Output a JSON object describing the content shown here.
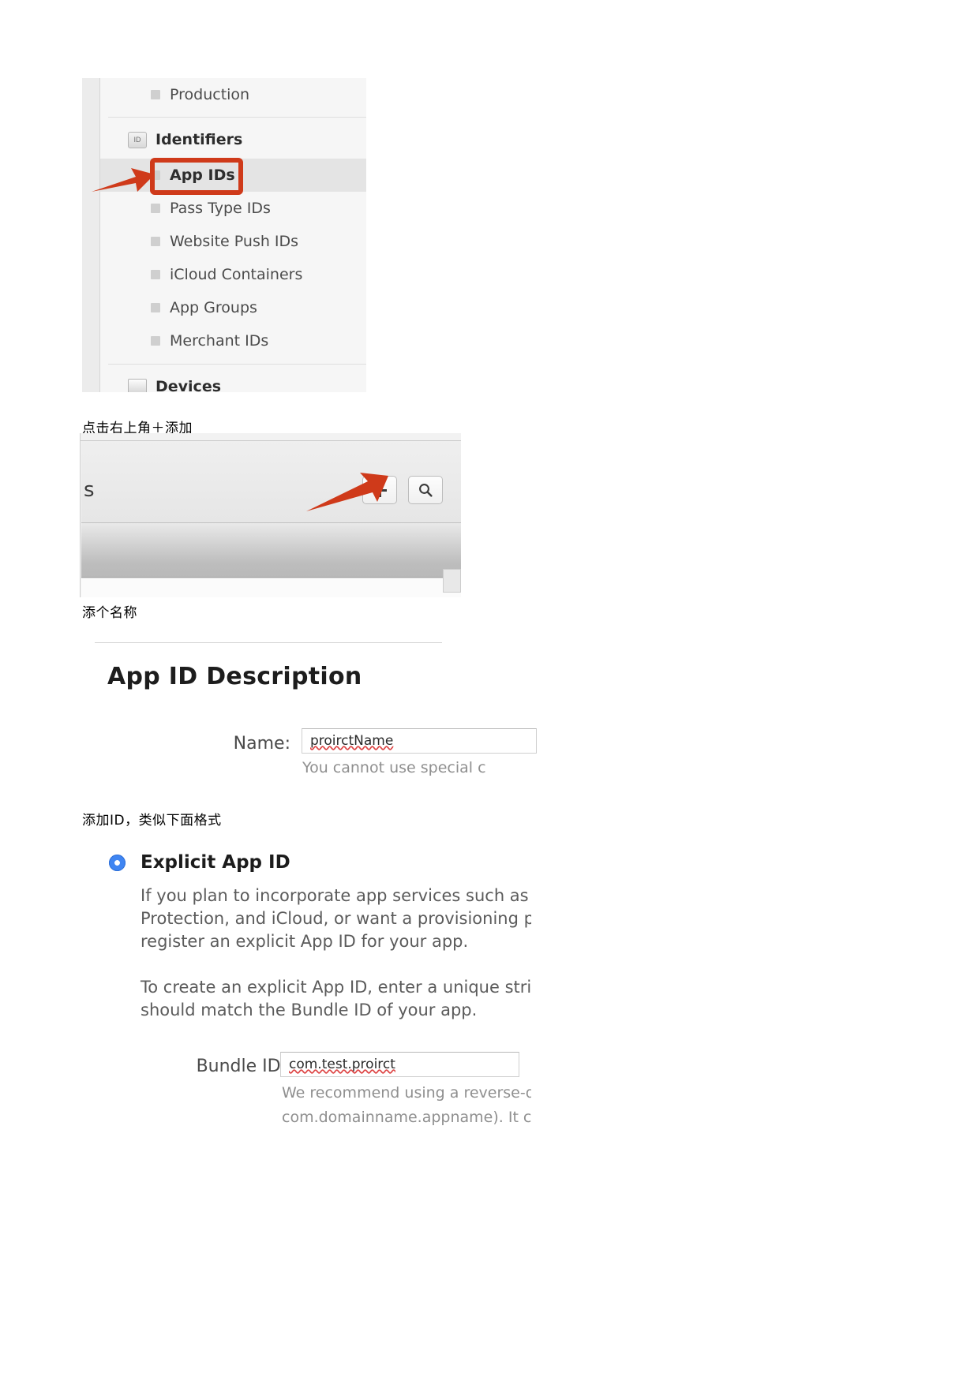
{
  "figure1": {
    "nav_items": [
      {
        "label": "Production",
        "type": "item",
        "selected": false
      },
      {
        "label": "Identifiers",
        "type": "group",
        "icon": "id-badge-icon",
        "icon_text": "ID"
      },
      {
        "label": "App IDs",
        "type": "item",
        "selected": true
      },
      {
        "label": "Pass Type IDs",
        "type": "item",
        "selected": false
      },
      {
        "label": "Website Push IDs",
        "type": "item",
        "selected": false
      },
      {
        "label": "iCloud Containers",
        "type": "item",
        "selected": false
      },
      {
        "label": "App Groups",
        "type": "item",
        "selected": false
      },
      {
        "label": "Merchant IDs",
        "type": "item",
        "selected": false
      },
      {
        "label": "Devices",
        "type": "group",
        "icon": "device-icon",
        "icon_text": ""
      }
    ],
    "highlight_color": "#cf3a1a",
    "arrow_color": "#cf3a1a"
  },
  "caption1": "点击右上角＋添加",
  "figure2": {
    "title_fragment": "s",
    "add_button_label": "+",
    "search_button_label": "search-icon",
    "arrow_color": "#cf3a1a"
  },
  "caption2": "添个名称",
  "figure3": {
    "heading": "App ID Description",
    "name_label": "Name:",
    "name_value": "proirctName",
    "name_hint": "You cannot use special c"
  },
  "caption3": "添加ID，类似下面格式",
  "figure4": {
    "option_title": "Explicit App ID",
    "paragraph1_lines": [
      "If you plan to incorporate app services such as G",
      "Protection, and iCloud, or want a provisioning pr",
      "register an explicit App ID for your app."
    ],
    "paragraph2_lines": [
      "To create an explicit App ID, enter a unique strin",
      "should match the Bundle ID of your app."
    ],
    "bundle_label": "Bundle ID:",
    "bundle_value": "com.test.proirct",
    "bundle_hint_lines": [
      "We recommend using a reverse-do",
      "com.domainname.appname). It can"
    ]
  }
}
